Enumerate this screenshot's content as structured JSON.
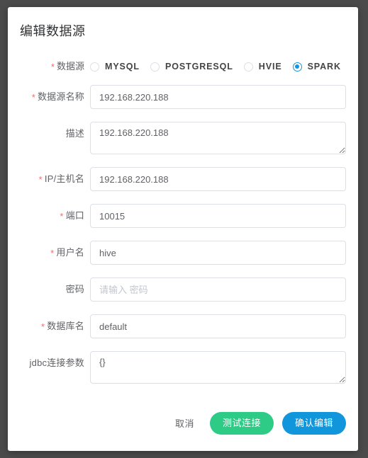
{
  "dialog": {
    "title": "编辑数据源"
  },
  "datasource_radio": {
    "label": "数据源",
    "required": true,
    "required_mark": "*",
    "selected": "SPARK",
    "options": [
      {
        "value": "MYSQL",
        "label": "MYSQL",
        "checked": false
      },
      {
        "value": "POSTGRESQL",
        "label": "POSTGRESQL",
        "checked": false
      },
      {
        "value": "HVIE",
        "label": "HVIE",
        "checked": false
      },
      {
        "value": "SPARK",
        "label": "SPARK",
        "checked": true
      }
    ]
  },
  "fields": [
    {
      "name": "datasource-name",
      "label": "数据源名称",
      "required": true,
      "required_mark": "*",
      "type": "input",
      "value": "192.168.220.188",
      "placeholder": ""
    },
    {
      "name": "description",
      "label": "描述",
      "required": false,
      "required_mark": "",
      "type": "textarea",
      "value": "192.168.220.188",
      "placeholder": ""
    },
    {
      "name": "ip-host",
      "label": "IP/主机名",
      "required": true,
      "required_mark": "*",
      "type": "input",
      "value": "192.168.220.188",
      "placeholder": ""
    },
    {
      "name": "port",
      "label": "端口",
      "required": true,
      "required_mark": "*",
      "type": "input",
      "value": "10015",
      "placeholder": ""
    },
    {
      "name": "username",
      "label": "用户名",
      "required": true,
      "required_mark": "*",
      "type": "input",
      "value": "hive",
      "placeholder": ""
    },
    {
      "name": "password",
      "label": "密码",
      "required": false,
      "required_mark": "",
      "type": "input",
      "value": "",
      "placeholder": "请输入 密码"
    },
    {
      "name": "database-name",
      "label": "数据库名",
      "required": true,
      "required_mark": "*",
      "type": "input",
      "value": "default",
      "placeholder": ""
    },
    {
      "name": "jdbc-params",
      "label": "jdbc连接参数",
      "required": false,
      "required_mark": "",
      "type": "textarea",
      "value": "{}",
      "placeholder": ""
    }
  ],
  "footer": {
    "cancel_label": "取消",
    "test_label": "测试连接",
    "confirm_label": "确认编辑"
  },
  "colors": {
    "accent_blue": "#1296db",
    "success_green": "#2ecb87",
    "required_red": "#f56c6c",
    "backdrop": "#4b4b4b"
  }
}
